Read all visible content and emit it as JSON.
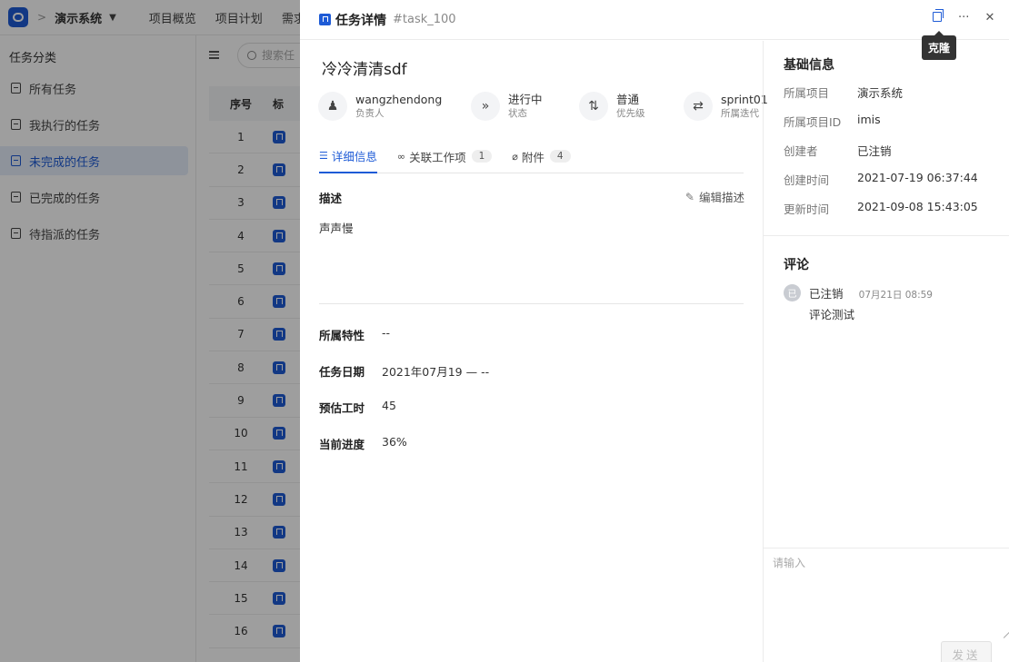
{
  "app": {
    "name": "演示系统",
    "nav": [
      "项目概览",
      "项目计划",
      "需求"
    ]
  },
  "sidebar": {
    "title": "任务分类",
    "items": [
      {
        "label": "所有任务",
        "active": false
      },
      {
        "label": "我执行的任务",
        "active": false
      },
      {
        "label": "未完成的任务",
        "active": true
      },
      {
        "label": "已完成的任务",
        "active": false
      },
      {
        "label": "待指派的任务",
        "active": false
      }
    ]
  },
  "list": {
    "search_placeholder": "搜索任",
    "columns": [
      "序号",
      "标"
    ],
    "rows": [
      "1",
      "2",
      "3",
      "4",
      "5",
      "6",
      "7",
      "8",
      "9",
      "10",
      "11",
      "12",
      "13",
      "14",
      "15",
      "16"
    ]
  },
  "drawer": {
    "title": "任务详情",
    "code": "#task_100",
    "tooltip": "克隆",
    "task_name": "冷冷清清sdf",
    "meta": [
      {
        "icon": "user-icon",
        "value": "wangzhendong",
        "label": "负责人"
      },
      {
        "icon": "status-icon",
        "value": "进行中",
        "label": "状态"
      },
      {
        "icon": "priority-icon",
        "value": "普通",
        "label": "优先级"
      },
      {
        "icon": "iteration-icon",
        "value": "sprint01",
        "label": "所属迭代"
      }
    ],
    "tabs": [
      {
        "label": "详细信息",
        "icon": "list-icon",
        "count": null,
        "active": true
      },
      {
        "label": "关联工作项",
        "icon": "link-icon",
        "count": "1",
        "active": false
      },
      {
        "label": "附件",
        "icon": "paperclip-icon",
        "count": "4",
        "active": false
      }
    ],
    "description": {
      "heading": "描述",
      "edit_label": "编辑描述",
      "text": "声声慢"
    },
    "props": [
      {
        "key": "所属特性",
        "value": "--"
      },
      {
        "key": "任务日期",
        "value": "2021年07月19 — --"
      },
      {
        "key": "预估工时",
        "value": "45"
      },
      {
        "key": "当前进度",
        "value": "36%"
      }
    ],
    "basic_info": {
      "title": "基础信息",
      "rows": [
        {
          "key": "所属项目",
          "value": "演示系统"
        },
        {
          "key": "所属项目ID",
          "value": "imis"
        },
        {
          "key": "创建者",
          "value": "已注销"
        },
        {
          "key": "创建时间",
          "value": "2021-07-19 06:37:44"
        },
        {
          "key": "更新时间",
          "value": "2021-09-08 15:43:05"
        }
      ]
    },
    "comments": {
      "title": "评论",
      "items": [
        {
          "avatar": "已",
          "author": "已注销",
          "time": "07月21日 08:59",
          "text": "评论测试"
        }
      ],
      "input_placeholder": "请输入",
      "send_label": "发送"
    }
  },
  "colors": {
    "accent": "#1e5bd6",
    "overlay": "rgba(0,0,0,0.38)"
  }
}
